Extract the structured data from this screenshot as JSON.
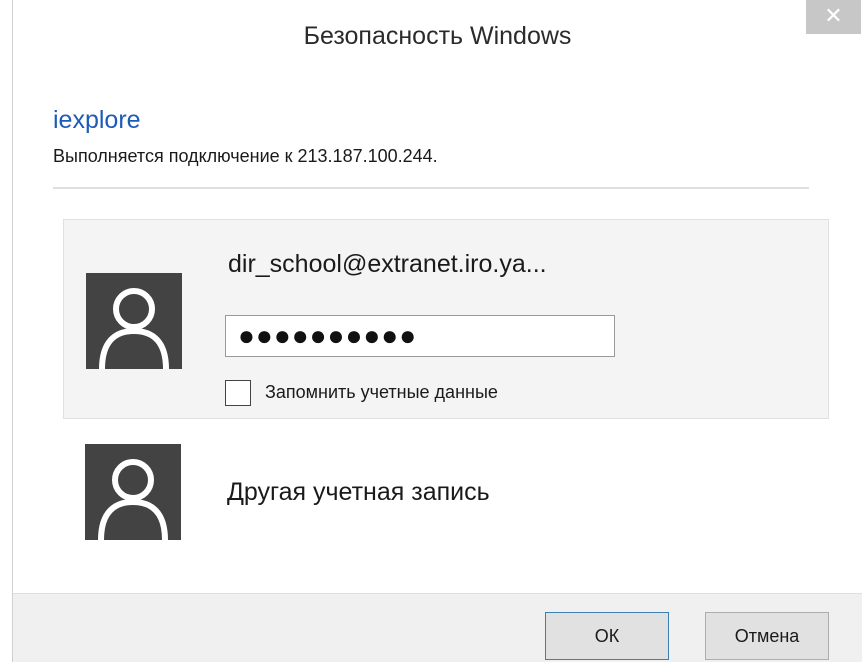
{
  "window": {
    "title": "Безопасность Windows",
    "close_icon": "✕"
  },
  "dialog": {
    "app_name": "iexplore",
    "subtitle": "Выполняется подключение к 213.187.100.244."
  },
  "selected_account": {
    "avatar_icon": "user-silhouette-icon",
    "username": "dir_school@extranet.iro.ya...",
    "password_mask": "●●●●●●●●●●",
    "remember_label": "Запомнить учетные данные",
    "remember_checked": false
  },
  "other_account": {
    "avatar_icon": "user-silhouette-icon",
    "label": "Другая учетная запись"
  },
  "buttons": {
    "ok": "ОК",
    "cancel": "Отмена"
  },
  "colors": {
    "app_name": "#1e5bb8",
    "avatar_bg": "#434343",
    "selected_bg": "#f4f4f4",
    "footer_bg": "#f0f0f0"
  }
}
